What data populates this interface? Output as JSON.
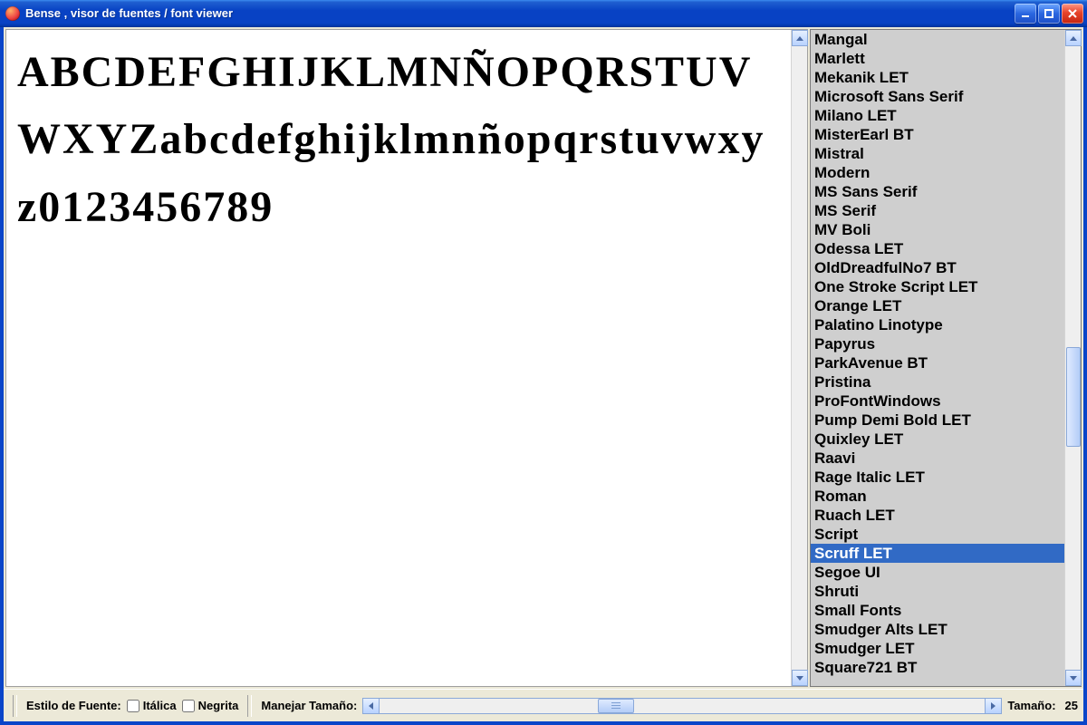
{
  "window": {
    "title": "Bense , visor de fuentes / font viewer"
  },
  "preview": {
    "sample_text": "ABCDEFGHIJKLMNÑOPQRSTUVWXYZabcdefghijklmnñopqrstuvwxyz0123456789"
  },
  "font_list": {
    "selected_index": 27,
    "items": [
      "Mangal",
      "Marlett",
      "Mekanik LET",
      "Microsoft Sans Serif",
      "Milano LET",
      "MisterEarl BT",
      "Mistral",
      "Modern",
      "MS Sans Serif",
      "MS Serif",
      "MV Boli",
      "Odessa LET",
      "OldDreadfulNo7 BT",
      "One Stroke Script LET",
      "Orange LET",
      "Palatino Linotype",
      "Papyrus",
      "ParkAvenue BT",
      "Pristina",
      "ProFontWindows",
      "Pump Demi Bold LET",
      "Quixley LET",
      "Raavi",
      "Rage Italic LET",
      "Roman",
      "Ruach LET",
      "Script",
      "Scruff LET",
      "Segoe UI",
      "Shruti",
      "Small Fonts",
      "Smudger Alts LET",
      "Smudger LET",
      "Square721 BT"
    ]
  },
  "status": {
    "style_label": "Estilo de Fuente:",
    "italic_label": "Itálica",
    "italic_checked": false,
    "bold_label": "Negrita",
    "bold_checked": false,
    "size_control_label": "Manejar Tamaño:",
    "size_readout_label": "Tamaño:",
    "size_value": "25",
    "slider_percent": 36
  },
  "colors": {
    "selection": "#316ac5",
    "xp_blue": "#0842c4"
  }
}
